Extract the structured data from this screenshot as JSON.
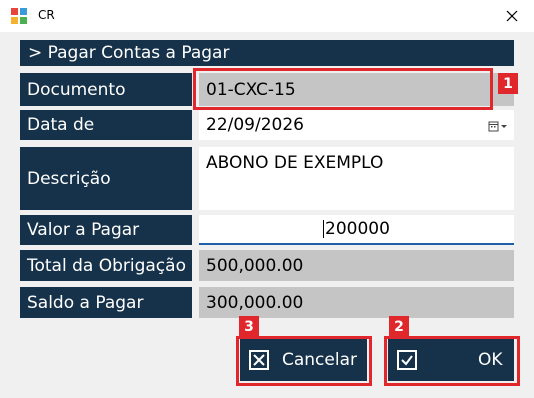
{
  "window": {
    "title": "CR",
    "close_icon": "close-icon",
    "app_icon": "app-icon"
  },
  "header": {
    "text": "> Pagar Contas a Pagar"
  },
  "fields": {
    "documento": {
      "label": "Documento",
      "value": "01-CXC-15"
    },
    "data_de": {
      "label": "Data de",
      "value": "22/09/2026",
      "icon": "calendar-dropdown-icon"
    },
    "descricao": {
      "label": "Descrição",
      "value": "ABONO DE EXEMPLO"
    },
    "valor_a_pagar": {
      "label": "Valor a Pagar",
      "value": "200000"
    },
    "total_obrigacao": {
      "label": "Total da Obrigação",
      "value": "500,000.00"
    },
    "saldo_a_pagar": {
      "label": "Saldo a Pagar",
      "value": "300,000.00"
    }
  },
  "buttons": {
    "cancel": {
      "label": "Cancelar",
      "icon": "x-box-icon"
    },
    "ok": {
      "label": "OK",
      "icon": "check-box-icon"
    }
  },
  "annotations": {
    "badge1": "1",
    "badge2": "2",
    "badge3": "3"
  },
  "colors": {
    "panel": "#16324a",
    "highlight": "#e0282c",
    "readonly": "#c5c5c5",
    "focus_underline": "#1f5fa8"
  }
}
